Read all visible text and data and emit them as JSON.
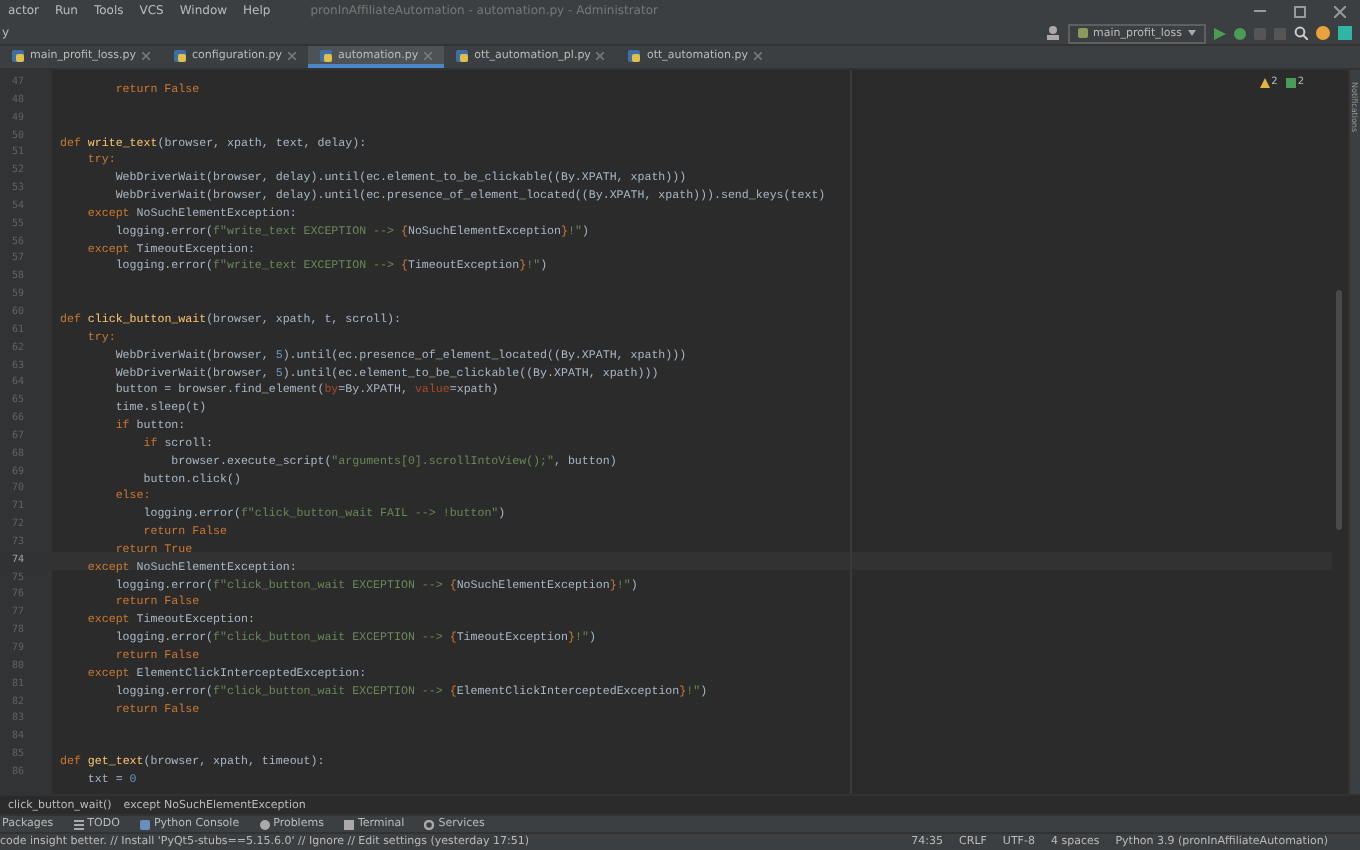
{
  "menu_bar": {
    "items": [
      "actor",
      "Run",
      "Tools",
      "VCS",
      "Window",
      "Help"
    ],
    "title": "pronInAffiliateAutomation - automation.py - Administrator"
  },
  "toolbar": {
    "path_fragment": "y",
    "run_configuration": "main_profit_loss"
  },
  "tabs": [
    {
      "label": "main_profit_loss.py",
      "selected": false
    },
    {
      "label": "configuration.py",
      "selected": false
    },
    {
      "label": "automation.py",
      "selected": true
    },
    {
      "label": "ott_automation_pl.py",
      "selected": false
    },
    {
      "label": "ott_automation.py",
      "selected": false
    }
  ],
  "inspections": {
    "warnings": "2",
    "passed": "2"
  },
  "side_strip": {
    "label": "Notifications"
  },
  "editor": {
    "lines": [
      {
        "number": "47",
        "current": false,
        "tokens": [
          {
            "kind": "kw",
            "text": "        return False"
          }
        ]
      },
      {
        "number": "48",
        "current": false
      },
      {
        "number": "49",
        "current": false
      },
      {
        "number": "50",
        "current": false,
        "tokens": [
          {
            "kind": "kw",
            "text": "def "
          },
          {
            "kind": "fn",
            "text": "write_text"
          },
          {
            "kind": "plain",
            "text": "(browser, xpath, text, delay):"
          }
        ]
      },
      {
        "number": "51",
        "current": false,
        "tokens": [
          {
            "kind": "kw",
            "text": "    try:"
          }
        ]
      },
      {
        "number": "52",
        "current": false,
        "tokens": [
          {
            "kind": "plain",
            "text": "        WebDriverWait(browser, delay).until(ec.element_to_be_clickable((By.XPATH, xpath)))"
          }
        ]
      },
      {
        "number": "53",
        "current": false,
        "tokens": [
          {
            "kind": "plain",
            "text": "        WebDriverWait(browser, delay).until(ec.presence_of_element_located((By.XPATH, xpath))).send_keys(text)"
          }
        ]
      },
      {
        "number": "54",
        "current": false,
        "tokens": [
          {
            "kind": "kw",
            "text": "    except "
          },
          {
            "kind": "plain",
            "text": "NoSuchElementException:"
          }
        ]
      },
      {
        "number": "55",
        "current": false,
        "tokens": [
          {
            "kind": "plain",
            "text": "        logging.error("
          },
          {
            "kind": "str",
            "text": "f\"write_text EXCEPTION --> "
          },
          {
            "kind": "kw",
            "text": "{"
          },
          {
            "kind": "plain",
            "text": "NoSuchElementException"
          },
          {
            "kind": "kw",
            "text": "}"
          },
          {
            "kind": "str",
            "text": "!\""
          },
          {
            "kind": "plain",
            "text": ")"
          }
        ]
      },
      {
        "number": "56",
        "current": false,
        "tokens": [
          {
            "kind": "kw",
            "text": "    except "
          },
          {
            "kind": "plain",
            "text": "TimeoutException:"
          }
        ]
      },
      {
        "number": "57",
        "current": false,
        "tokens": [
          {
            "kind": "plain",
            "text": "        logging.error("
          },
          {
            "kind": "str",
            "text": "f\"write_text EXCEPTION --> "
          },
          {
            "kind": "kw",
            "text": "{"
          },
          {
            "kind": "plain",
            "text": "TimeoutException"
          },
          {
            "kind": "kw",
            "text": "}"
          },
          {
            "kind": "str",
            "text": "!\""
          },
          {
            "kind": "plain",
            "text": ")"
          }
        ]
      },
      {
        "number": "58",
        "current": false
      },
      {
        "number": "59",
        "current": false
      },
      {
        "number": "60",
        "current": false,
        "tokens": [
          {
            "kind": "kw",
            "text": "def "
          },
          {
            "kind": "fn",
            "text": "click_button_wait"
          },
          {
            "kind": "plain",
            "text": "(browser, xpath, t, scroll):"
          }
        ]
      },
      {
        "number": "61",
        "current": false,
        "tokens": [
          {
            "kind": "kw",
            "text": "    try:"
          }
        ]
      },
      {
        "number": "62",
        "current": false,
        "tokens": [
          {
            "kind": "plain",
            "text": "        WebDriverWait(browser, "
          },
          {
            "kind": "num",
            "text": "5"
          },
          {
            "kind": "plain",
            "text": ").until(ec.presence_of_element_located((By.XPATH, xpath)))"
          }
        ]
      },
      {
        "number": "63",
        "current": false,
        "tokens": [
          {
            "kind": "plain",
            "text": "        WebDriverWait(browser, "
          },
          {
            "kind": "num",
            "text": "5"
          },
          {
            "kind": "plain",
            "text": ").until(ec.element_to_be_clickable((By.XPATH, xpath)))"
          }
        ]
      },
      {
        "number": "64",
        "current": false,
        "tokens": [
          {
            "kind": "plain",
            "text": "        button = browser.find_element("
          },
          {
            "kind": "named",
            "text": "by"
          },
          {
            "kind": "plain",
            "text": "=By.XPATH, "
          },
          {
            "kind": "named",
            "text": "value"
          },
          {
            "kind": "plain",
            "text": "=xpath)"
          }
        ]
      },
      {
        "number": "65",
        "current": false,
        "tokens": [
          {
            "kind": "plain",
            "text": "        time.sleep(t)"
          }
        ]
      },
      {
        "number": "66",
        "current": false,
        "tokens": [
          {
            "kind": "kw",
            "text": "        if "
          },
          {
            "kind": "plain",
            "text": "button:"
          }
        ]
      },
      {
        "number": "67",
        "current": false,
        "tokens": [
          {
            "kind": "kw",
            "text": "            if "
          },
          {
            "kind": "plain",
            "text": "scroll:"
          }
        ]
      },
      {
        "number": "68",
        "current": false,
        "tokens": [
          {
            "kind": "plain",
            "text": "                browser.execute_script("
          },
          {
            "kind": "str",
            "text": "\"arguments[0].scrollIntoView();\""
          },
          {
            "kind": "plain",
            "text": ", button)"
          }
        ]
      },
      {
        "number": "69",
        "current": false,
        "tokens": [
          {
            "kind": "plain",
            "text": "            button.click()"
          }
        ]
      },
      {
        "number": "70",
        "current": false,
        "tokens": [
          {
            "kind": "kw",
            "text": "        else:"
          }
        ]
      },
      {
        "number": "71",
        "current": false,
        "tokens": [
          {
            "kind": "plain",
            "text": "            logging.error("
          },
          {
            "kind": "str",
            "text": "f\"click_button_wait FAIL --> !button\""
          },
          {
            "kind": "plain",
            "text": ")"
          }
        ]
      },
      {
        "number": "72",
        "current": false,
        "tokens": [
          {
            "kind": "kw",
            "text": "            return False"
          }
        ]
      },
      {
        "number": "73",
        "current": false,
        "tokens": [
          {
            "kind": "kw",
            "text": "        return True"
          }
        ]
      },
      {
        "number": "74",
        "current": true,
        "tokens": [
          {
            "kind": "kw",
            "text": "    except "
          },
          {
            "kind": "plain",
            "text": "NoSuchElementException:"
          }
        ]
      },
      {
        "number": "75",
        "current": false,
        "tokens": [
          {
            "kind": "plain",
            "text": "        logging.error("
          },
          {
            "kind": "str",
            "text": "f\"click_button_wait EXCEPTION --> "
          },
          {
            "kind": "kw",
            "text": "{"
          },
          {
            "kind": "plain",
            "text": "NoSuchElementException"
          },
          {
            "kind": "kw",
            "text": "}"
          },
          {
            "kind": "str",
            "text": "!\""
          },
          {
            "kind": "plain",
            "text": ")"
          }
        ]
      },
      {
        "number": "76",
        "current": false,
        "tokens": [
          {
            "kind": "kw",
            "text": "        return False"
          }
        ]
      },
      {
        "number": "77",
        "current": false,
        "tokens": [
          {
            "kind": "kw",
            "text": "    except "
          },
          {
            "kind": "plain",
            "text": "TimeoutException:"
          }
        ]
      },
      {
        "number": "78",
        "current": false,
        "tokens": [
          {
            "kind": "plain",
            "text": "        logging.error("
          },
          {
            "kind": "str",
            "text": "f\"click_button_wait EXCEPTION --> "
          },
          {
            "kind": "kw",
            "text": "{"
          },
          {
            "kind": "plain",
            "text": "TimeoutException"
          },
          {
            "kind": "kw",
            "text": "}"
          },
          {
            "kind": "str",
            "text": "!\""
          },
          {
            "kind": "plain",
            "text": ")"
          }
        ]
      },
      {
        "number": "79",
        "current": false,
        "tokens": [
          {
            "kind": "kw",
            "text": "        return False"
          }
        ]
      },
      {
        "number": "80",
        "current": false,
        "tokens": [
          {
            "kind": "kw",
            "text": "    except "
          },
          {
            "kind": "plain",
            "text": "ElementClickInterceptedException:"
          }
        ]
      },
      {
        "number": "81",
        "current": false,
        "tokens": [
          {
            "kind": "plain",
            "text": "        logging.error("
          },
          {
            "kind": "str",
            "text": "f\"click_button_wait EXCEPTION --> "
          },
          {
            "kind": "kw",
            "text": "{"
          },
          {
            "kind": "plain",
            "text": "ElementClickInterceptedException"
          },
          {
            "kind": "kw",
            "text": "}"
          },
          {
            "kind": "str",
            "text": "!\""
          },
          {
            "kind": "plain",
            "text": ")"
          }
        ]
      },
      {
        "number": "82",
        "current": false,
        "tokens": [
          {
            "kind": "kw",
            "text": "        return False"
          }
        ]
      },
      {
        "number": "83",
        "current": false
      },
      {
        "number": "84",
        "current": false
      },
      {
        "number": "85",
        "current": false,
        "tokens": [
          {
            "kind": "kw",
            "text": "def "
          },
          {
            "kind": "fn",
            "text": "get_text"
          },
          {
            "kind": "plain",
            "text": "(browser, xpath, timeout):"
          }
        ]
      },
      {
        "number": "86",
        "current": false,
        "tokens": [
          {
            "kind": "plain",
            "text": "    txt = "
          },
          {
            "kind": "num",
            "text": "0"
          }
        ]
      }
    ]
  },
  "breadcrumbs": [
    "click_button_wait()",
    "except NoSuchElementException"
  ],
  "tool_windows": [
    {
      "kind": "plain",
      "label": "Packages"
    },
    {
      "kind": "list",
      "label": "TODO"
    },
    {
      "kind": "console",
      "label": "Python Console"
    },
    {
      "kind": "info",
      "label": "Problems"
    },
    {
      "kind": "terminal",
      "label": "Terminal"
    },
    {
      "kind": "services",
      "label": "Services"
    }
  ],
  "status_bar": {
    "message": "code insight better. // Install 'PyQt5-stubs==5.15.6.0' // Ignore // Edit settings (yesterday 17:51)",
    "items": [
      "74:35",
      "CRLF",
      "UTF-8",
      "4 spaces",
      "Python 3.9 (pronInAffiliateAutomation)"
    ]
  }
}
